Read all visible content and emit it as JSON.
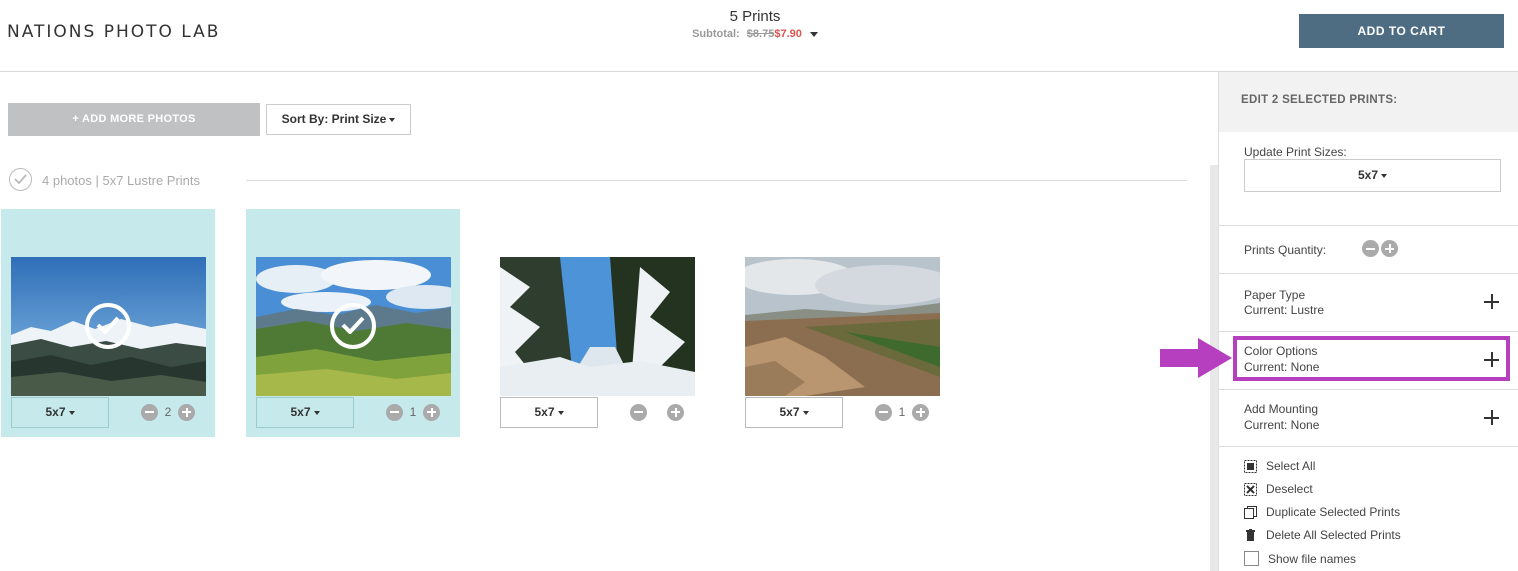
{
  "header": {
    "logo": "NATIONS PHOTO LAB",
    "prints_count": "5 Prints",
    "subtotal_label": "Subtotal:",
    "subtotal_old": "$8.75",
    "subtotal_new": "$7.90",
    "add_to_cart": "ADD TO CART"
  },
  "toolbar": {
    "add_photos": "+ ADD MORE PHOTOS",
    "sort_by": "Sort By: Print Size"
  },
  "group": {
    "label": "4 photos  |  5x7 Lustre Prints"
  },
  "photos": [
    {
      "size": "5x7",
      "qty": "2",
      "selected": true,
      "scene": "snowy-mountains"
    },
    {
      "size": "5x7",
      "qty": "1",
      "selected": true,
      "scene": "green-hills"
    },
    {
      "size": "5x7",
      "qty": "",
      "selected": false,
      "scene": "snowy-forest-road"
    },
    {
      "size": "5x7",
      "qty": "1",
      "selected": false,
      "scene": "desert-ridge"
    }
  ],
  "panel": {
    "title": "EDIT 2 SELECTED PRINTS:",
    "update_sizes_label": "Update Print Sizes:",
    "update_sizes_value": "5x7",
    "quantity_label": "Prints Quantity:",
    "paper_type_label": "Paper Type",
    "paper_type_current": "Current: Lustre",
    "color_options_label": "Color Options",
    "color_options_current": "Current: None",
    "mounting_label": "Add Mounting",
    "mounting_current": "Current: None",
    "actions": {
      "select_all": "Select All",
      "deselect": "Deselect",
      "duplicate": "Duplicate Selected Prints",
      "delete": "Delete All Selected Prints",
      "show_names": "Show file names"
    }
  },
  "colors": {
    "cart_button": "#4f6d82",
    "selected_card": "#c6e9ec",
    "highlight": "#b53fbf",
    "price_new": "#d9534f"
  }
}
